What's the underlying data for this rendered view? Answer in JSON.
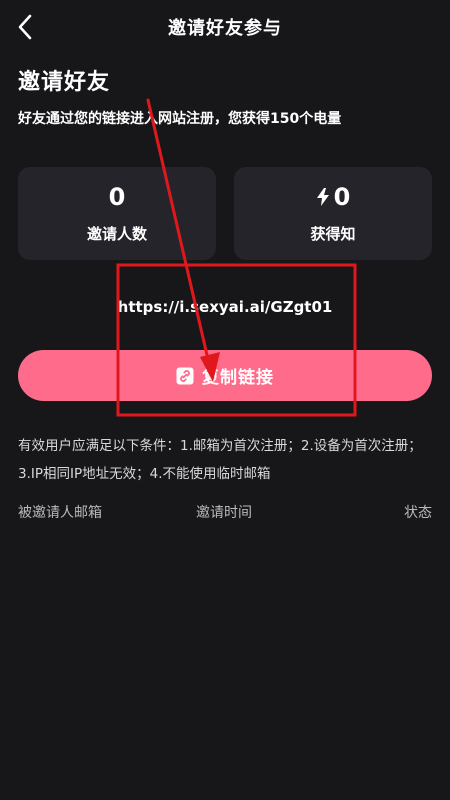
{
  "header": {
    "title": "邀请好友参与",
    "back_icon": "chevron-left-icon"
  },
  "intro": {
    "title": "邀请好友",
    "subtitle": "好友通过您的链接进入网站注册，您获得150个电量"
  },
  "stats": {
    "invited": {
      "value": "0",
      "label": "邀请人数"
    },
    "earned": {
      "value": "0",
      "label": "获得知",
      "icon": "lightning-icon"
    }
  },
  "invite": {
    "link": "https://i.sexyai.ai/GZgt01",
    "copy_label": "复制链接",
    "copy_icon": "link-icon"
  },
  "rules": {
    "text": "有效用户应满足以下条件：1.邮箱为首次注册；2.设备为首次注册；3.IP相同IP地址无效；4.不能使用临时邮箱"
  },
  "table": {
    "columns": [
      "被邀请人邮箱",
      "邀请时间",
      "状态"
    ]
  },
  "colors": {
    "background": "#17171a",
    "card": "#24242a",
    "accent": "#ff6b8b",
    "annotation": "#e0181e"
  }
}
